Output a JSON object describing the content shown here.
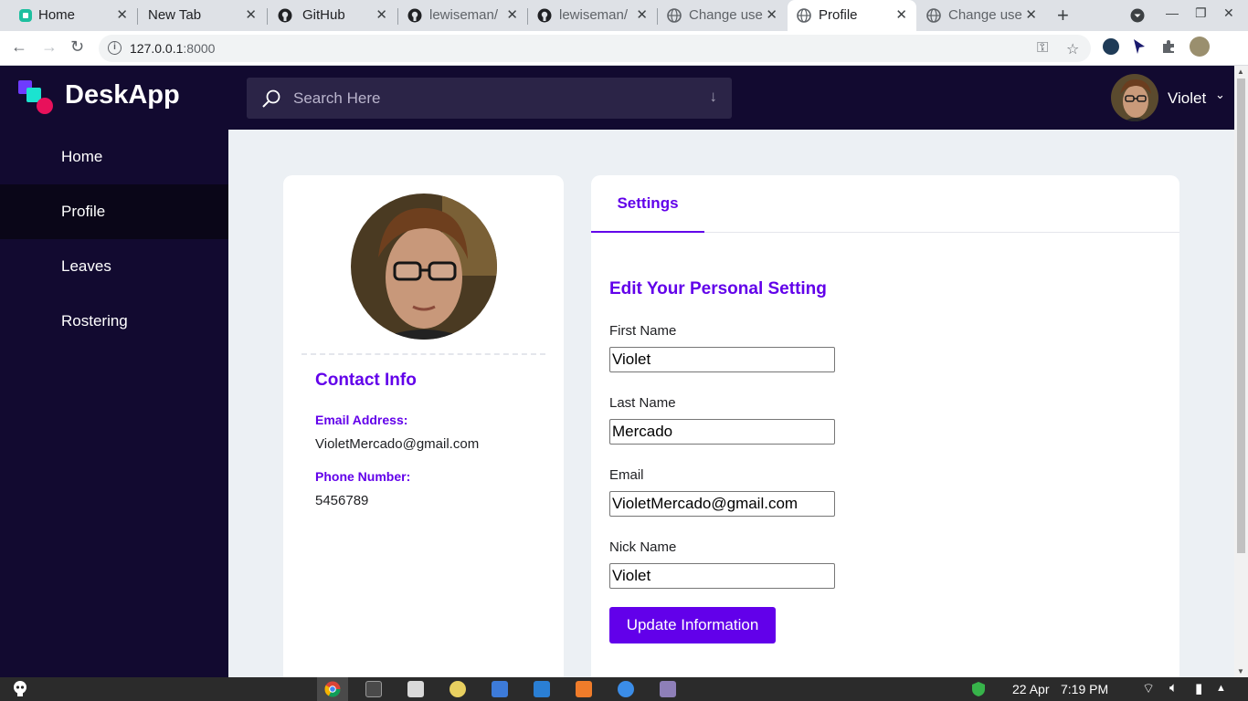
{
  "browser": {
    "tabs": [
      {
        "label": "Home"
      },
      {
        "label": "New Tab"
      },
      {
        "label": "GitHub"
      },
      {
        "label": "lewiseman/"
      },
      {
        "label": "lewiseman/"
      },
      {
        "label": "Change use"
      },
      {
        "label": "Profile"
      },
      {
        "label": "Change use"
      }
    ],
    "url_host": "127.0.0.1",
    "url_port": ":8000"
  },
  "app": {
    "brand": "DeskApp",
    "search_placeholder": "Search Here",
    "user_name": "Violet",
    "nav": [
      {
        "label": "Home"
      },
      {
        "label": "Profile"
      },
      {
        "label": "Leaves"
      },
      {
        "label": "Rostering"
      }
    ]
  },
  "profile": {
    "contact_title": "Contact Info",
    "email_label": "Email Address:",
    "email_value": "VioletMercado@gmail.com",
    "phone_label": "Phone Number:",
    "phone_value": "5456789"
  },
  "settings": {
    "tab_label": "Settings",
    "title": "Edit Your Personal Setting",
    "fields": [
      {
        "label": "First Name",
        "value": "Violet"
      },
      {
        "label": "Last Name",
        "value": "Mercado"
      },
      {
        "label": "Email",
        "value": "VioletMercado@gmail.com"
      },
      {
        "label": "Nick Name",
        "value": "Violet"
      }
    ],
    "button_label": "Update Information"
  },
  "taskbar": {
    "date": "22 Apr",
    "time": "7:19 PM"
  }
}
